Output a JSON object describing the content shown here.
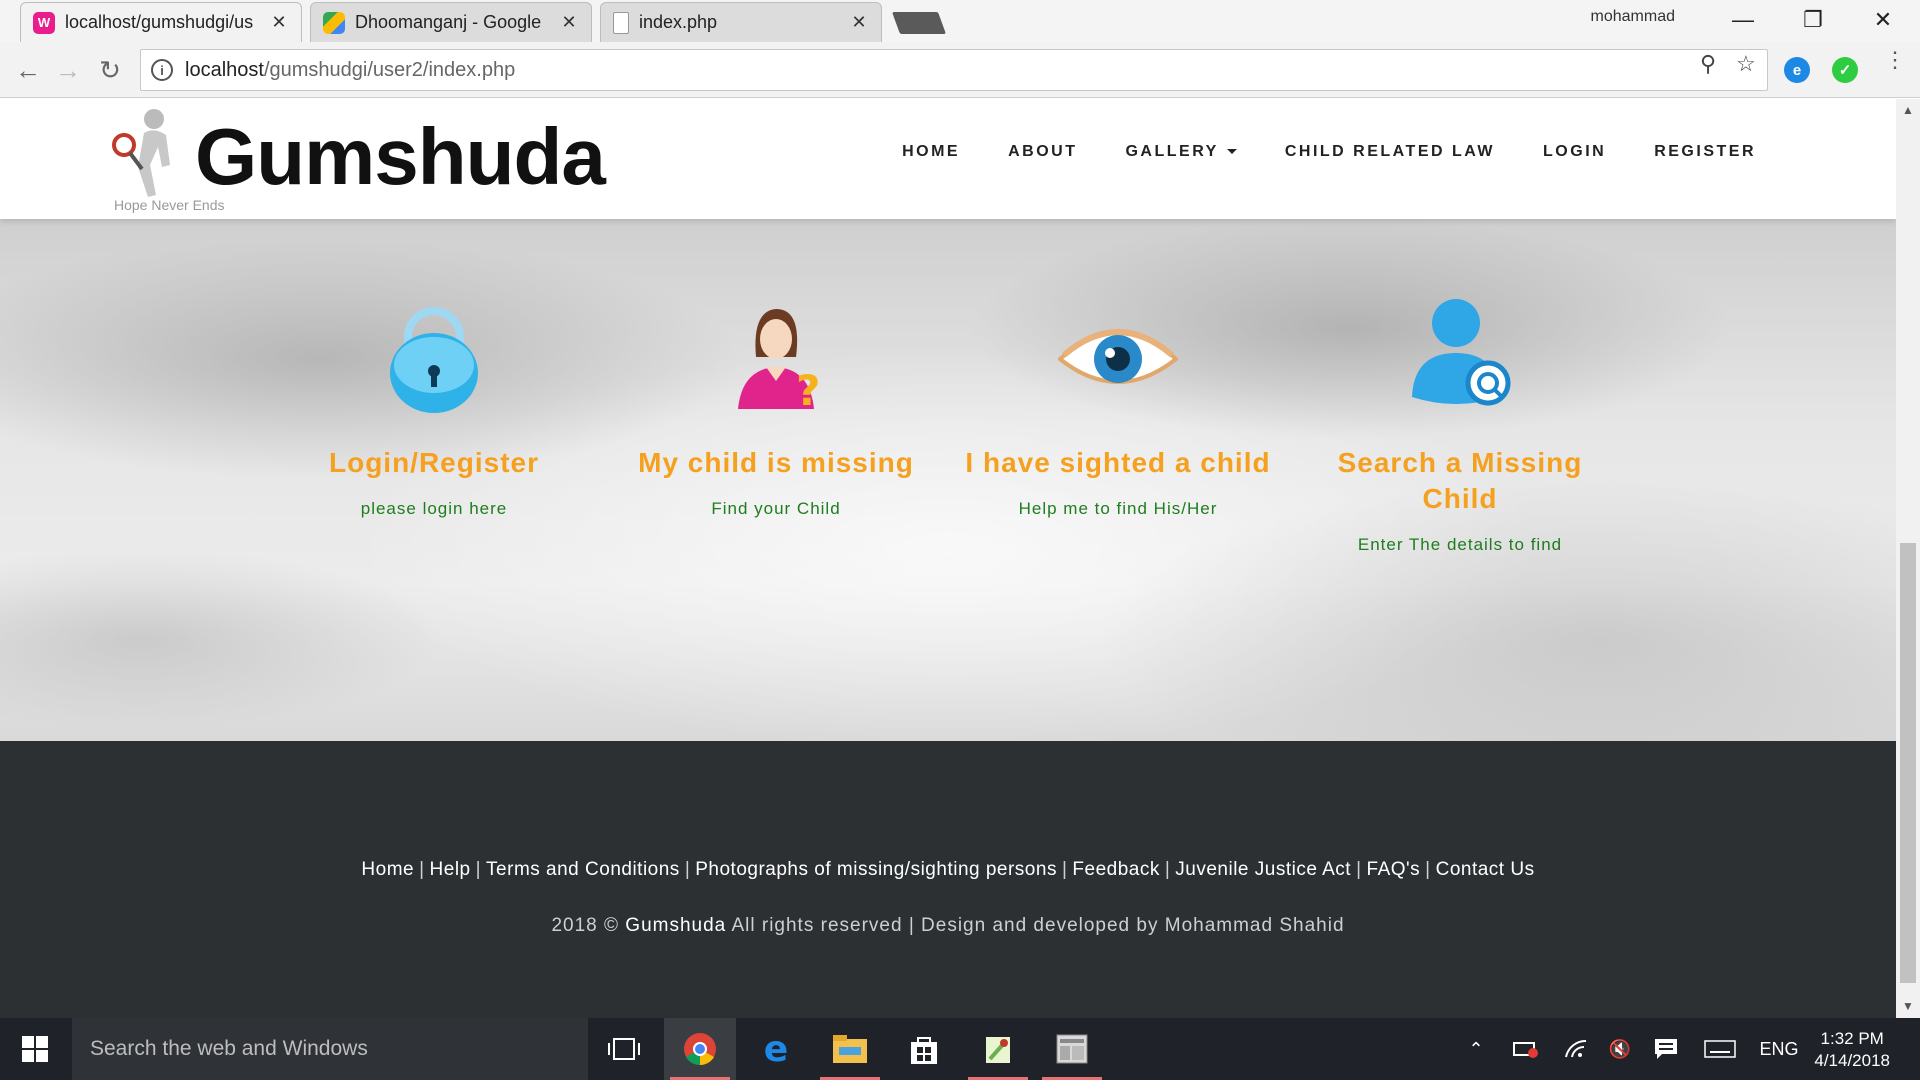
{
  "browser": {
    "tabs": [
      {
        "title": "localhost/gumshudgi/us",
        "favicon": "wamp-icon",
        "active": true
      },
      {
        "title": "Dhoomanganj - Google",
        "favicon": "maps-icon",
        "active": false
      },
      {
        "title": "index.php",
        "favicon": "page-icon",
        "active": false
      }
    ],
    "close_glyph": "✕",
    "user": "mohammad",
    "address": {
      "host": "localhost",
      "path": "/gumshudgi/user2/index.php"
    }
  },
  "site": {
    "logo_text": "Gumshuda",
    "tagline": "Hope Never Ends",
    "nav": [
      "HOME",
      "ABOUT",
      "GALLERY",
      "CHILD RELATED LAW",
      "LOGIN",
      "REGISTER"
    ],
    "features": [
      {
        "icon": "padlock-icon",
        "title": "Login/Register",
        "subtitle": "please login here"
      },
      {
        "icon": "missing-child-woman-icon",
        "title": "My child is missing",
        "subtitle": "Find your Child"
      },
      {
        "icon": "eye-icon",
        "title": "I have sighted a child",
        "subtitle": "Help me to find His/Her"
      },
      {
        "icon": "user-search-icon",
        "title": "Search a Missing Child",
        "subtitle": "Enter The details to find"
      }
    ],
    "footer": {
      "links": [
        "Home",
        "Help",
        "Terms and Conditions",
        "Photographs of missing/sighting persons",
        "Feedback",
        "Juvenile Justice Act",
        "FAQ's",
        "Contact Us"
      ],
      "copyright_prefix": "2018 ©",
      "brand": "Gumshuda",
      "copyright_suffix": "All rights reserved | Design and developed by Mohammad Shahid"
    }
  },
  "taskbar": {
    "search_placeholder": "Search the web and Windows",
    "language": "ENG",
    "time": "1:32 PM",
    "date": "4/14/2018"
  },
  "colors": {
    "feature_title": "#f5a01f",
    "feature_subtitle": "#1e7d1e",
    "footer_bg": "#2c3033",
    "accent_blue": "#1e88e5"
  }
}
